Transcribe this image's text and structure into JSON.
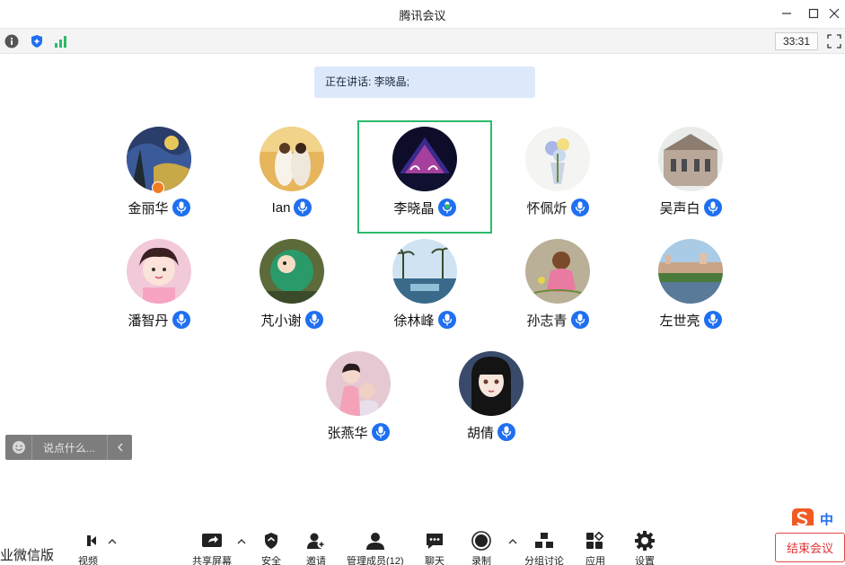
{
  "window": {
    "title": "腾讯会议",
    "controls": [
      "minimize-icon",
      "maximize-icon",
      "close-icon"
    ]
  },
  "toolbar": {
    "timer": "33:31",
    "icons": [
      "info-icon",
      "shield-icon",
      "signal-icon",
      "fullscreen-icon"
    ]
  },
  "speaking": {
    "label": "正在讲话: 李晓晶;"
  },
  "participants": [
    {
      "name": "金丽华",
      "mic": "mic-icon"
    },
    {
      "name": "Ian",
      "mic": "mic-icon"
    },
    {
      "name": "李晓晶",
      "mic": "mic-active-icon"
    },
    {
      "name": "怀佩炘",
      "mic": "mic-icon"
    },
    {
      "name": "吴声白",
      "mic": "mic-icon"
    },
    {
      "name": "潘智丹",
      "mic": "mic-icon"
    },
    {
      "name": "芃小谢",
      "mic": "mic-icon"
    },
    {
      "name": "徐林峰",
      "mic": "mic-icon"
    },
    {
      "name": "孙志青",
      "mic": "mic-icon"
    },
    {
      "name": "左世亮",
      "mic": "mic-icon"
    },
    {
      "name": "张燕华",
      "mic": "mic-icon"
    },
    {
      "name": "胡倩",
      "mic": "mic-icon"
    }
  ],
  "chat": {
    "placeholder": "说点什么..."
  },
  "bottom": {
    "wechat_label": "业微信版",
    "buttons": [
      {
        "label": "视频",
        "icon": "video-icon"
      },
      {
        "label": "共享屏幕",
        "icon": "share-screen-icon"
      },
      {
        "label": "安全",
        "icon": "security-icon"
      },
      {
        "label": "邀请",
        "icon": "invite-icon"
      },
      {
        "label": "管理成员(12)",
        "icon": "members-icon"
      },
      {
        "label": "聊天",
        "icon": "chat-icon"
      },
      {
        "label": "录制",
        "icon": "record-icon"
      },
      {
        "label": "分组讨论",
        "icon": "breakout-icon"
      },
      {
        "label": "应用",
        "icon": "apps-icon"
      },
      {
        "label": "设置",
        "icon": "settings-icon"
      }
    ],
    "end_meeting": "结束会议"
  },
  "ime": {
    "label": "中"
  },
  "colors": {
    "accent": "#1f6ff0",
    "active_speaker": "#2cba6b",
    "speaking_bg": "#dde9fa",
    "end_meeting": "#e03333"
  }
}
